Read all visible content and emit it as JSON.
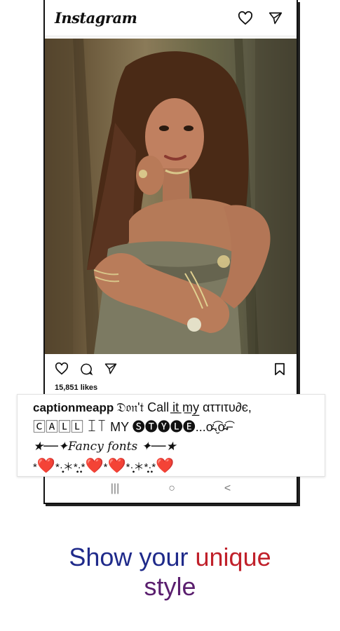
{
  "app": {
    "name": "Instagram"
  },
  "header": {
    "icons": [
      "heart-icon",
      "send-icon"
    ]
  },
  "post": {
    "image": "woman-portrait-photo",
    "actions": [
      "heart-icon",
      "comment-icon",
      "send-icon",
      "bookmark-icon"
    ],
    "likes": "15,851 likes"
  },
  "caption": {
    "username": "captionmeapp",
    "line1_text": "𝔇𝔬𝔫'𝔱 Call i̲t̲ m̲y̲ ατтιτυ∂є,",
    "line2_text": "🄲🄰🄻🄻 ꀤ꓄ MY 🅢🅣🅨🅛🅔...ơ̴̴͡.̮ơ̴̴͡⌐",
    "line3_text": "★──✦Fancy fonts ✦──★",
    "line4_parts": [
      "*",
      "❤️",
      "*·̩̩̥͙＊*̩̩̥͙·̩̩̥",
      "*",
      "❤️",
      "*",
      "❤️",
      "*·̩̩̥͙＊*̩̩̥͙·̩̩̥",
      "*",
      "❤️"
    ]
  },
  "nav": {
    "recents": "|||",
    "home": "○",
    "back": "<"
  },
  "tagline": {
    "word1": "Show",
    "word2": "your",
    "word3": "unique",
    "word4": "style"
  },
  "colors": {
    "tagline_blue": "#1f2a8a",
    "tagline_red": "#c0202a",
    "tagline_purple": "#5a1e6e",
    "heart": "#e0202a"
  }
}
